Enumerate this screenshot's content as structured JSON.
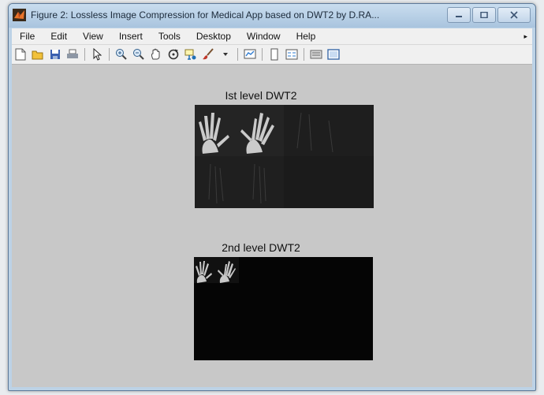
{
  "window": {
    "title": "Figure 2: Lossless Image Compression for Medical App based on DWT2 by D.RA...",
    "controls": [
      "minimize",
      "maximize",
      "close"
    ]
  },
  "menubar": {
    "items": [
      "File",
      "Edit",
      "View",
      "Insert",
      "Tools",
      "Desktop",
      "Window",
      "Help"
    ]
  },
  "toolbar": {
    "icons": [
      "new-figure-icon",
      "open-file-icon",
      "save-icon",
      "print-icon",
      "edit-plot-arrow-icon",
      "zoom-in-icon",
      "zoom-out-icon",
      "pan-hand-icon",
      "rotate-3d-icon",
      "data-cursor-icon",
      "brush-icon",
      "link-plot-icon",
      "colorbar-icon",
      "legend-icon",
      "hide-plot-tools-icon",
      "show-plot-tools-icon"
    ]
  },
  "figure": {
    "axes": [
      {
        "title": "Ist level DWT2"
      },
      {
        "title": "2nd level DWT2"
      }
    ]
  },
  "colors": {
    "figure_background": "#c8c8c8",
    "axes_background": "#000000",
    "titlebar": "#bcd2e6"
  }
}
